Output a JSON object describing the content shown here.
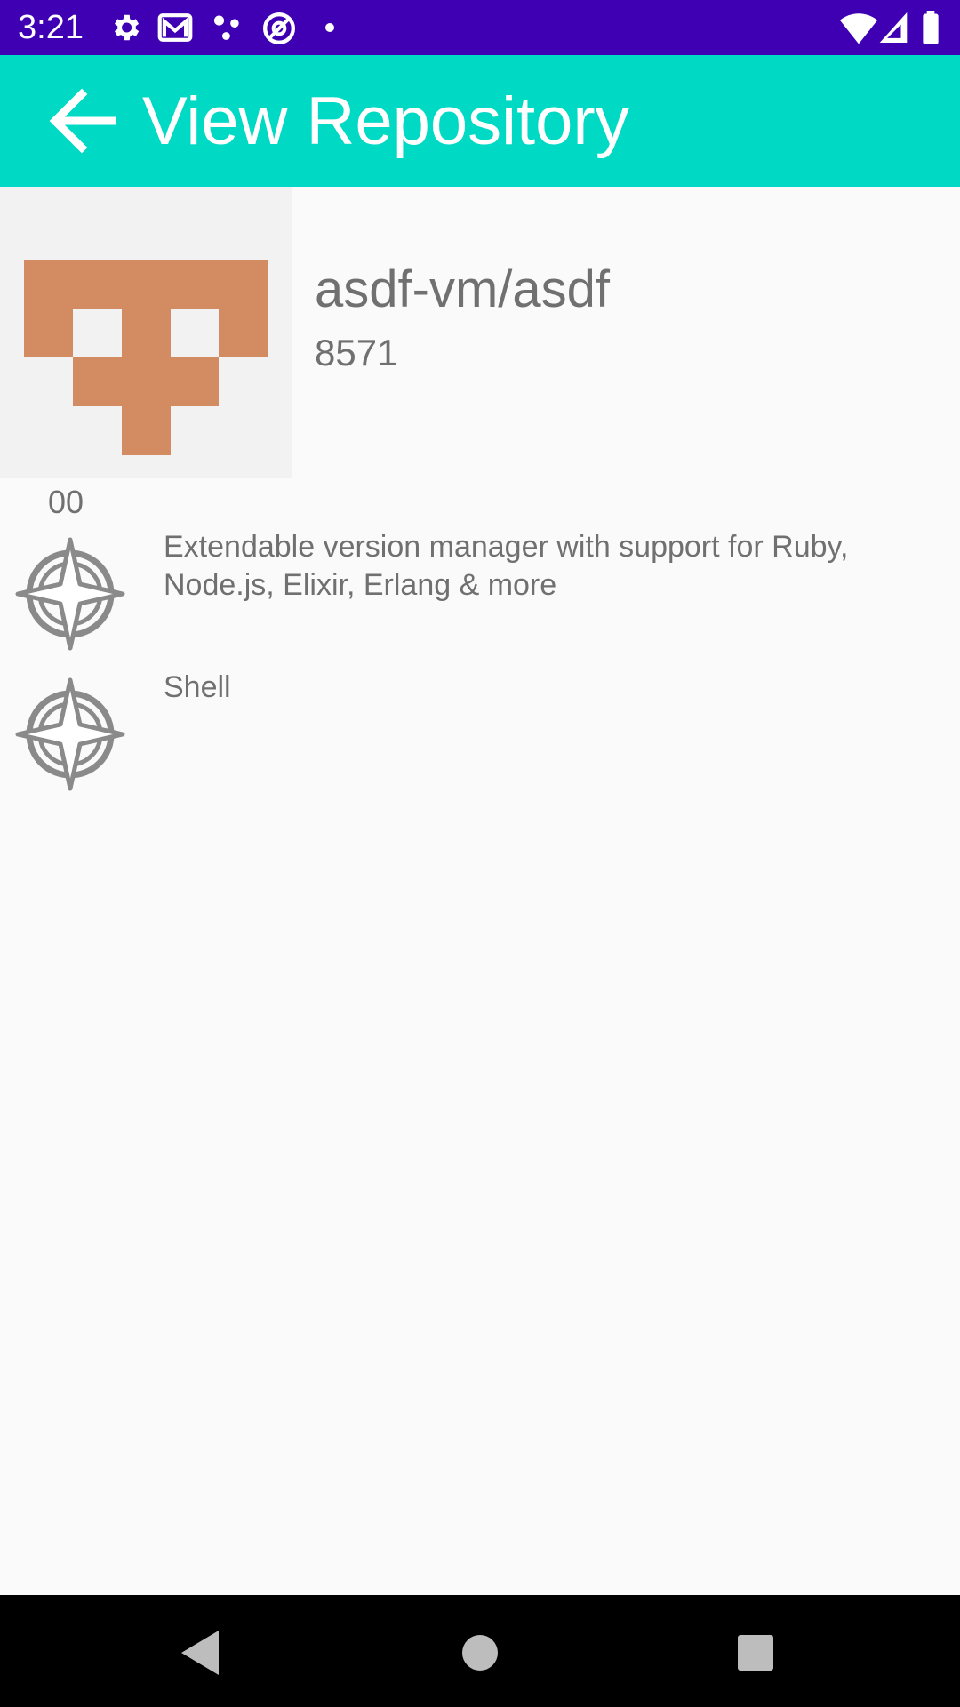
{
  "status_bar": {
    "time": "3:21",
    "left_icons": [
      "gear-icon",
      "gmail-icon",
      "dots-icon",
      "at-circle-icon",
      "notification-dot-icon"
    ],
    "right_icons": [
      "wifi-icon",
      "signal-icon",
      "battery-icon"
    ],
    "background": "#3f00b3"
  },
  "app_bar": {
    "title": "View Repository",
    "back_icon": "arrow-back-icon",
    "background": "#00d9c4"
  },
  "repo": {
    "name": "asdf-vm/asdf",
    "stars": "8571",
    "count_label": "00",
    "avatar_color": "#d38c61"
  },
  "details": [
    {
      "icon": "compass-icon",
      "text": "Extendable version manager with support for Ruby, Node.js, Elixir, Erlang & more"
    },
    {
      "icon": "compass-icon",
      "text": "Shell"
    }
  ],
  "nav_bar": {
    "back_icon": "nav-back-icon",
    "home_icon": "nav-home-icon",
    "recents_icon": "nav-recents-icon"
  }
}
